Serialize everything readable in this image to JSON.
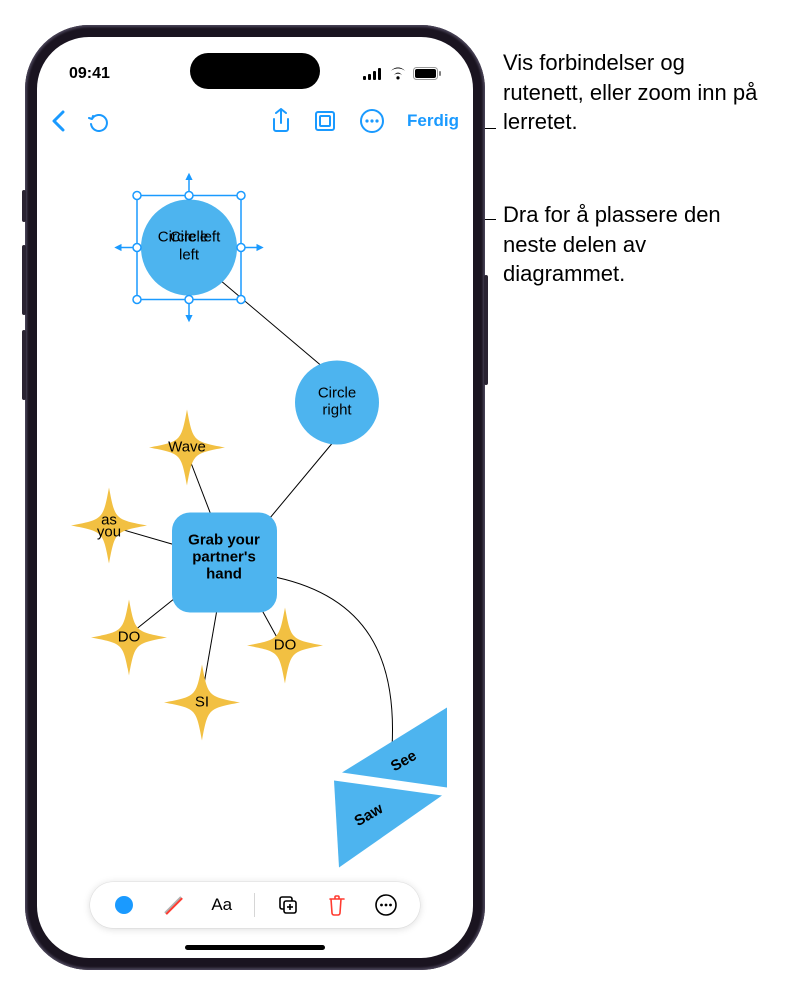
{
  "status": {
    "time": "09:41"
  },
  "toolbar": {
    "done_label": "Ferdig"
  },
  "nodes": {
    "circle_left": "Circle left",
    "circle_right": "Circle right",
    "grab": "Grab your partner's hand",
    "wave": "Wave",
    "as_you": "as you",
    "do1": "DO",
    "do2": "DO",
    "si": "SI",
    "see": "See",
    "saw": "Saw"
  },
  "bottom_tools": {
    "text_label": "Aa"
  },
  "callouts": {
    "c1": "Vis forbindelser og rutenett, eller zoom inn på lerretet.",
    "c2": "Dra for å plassere den neste delen av diagrammet."
  }
}
